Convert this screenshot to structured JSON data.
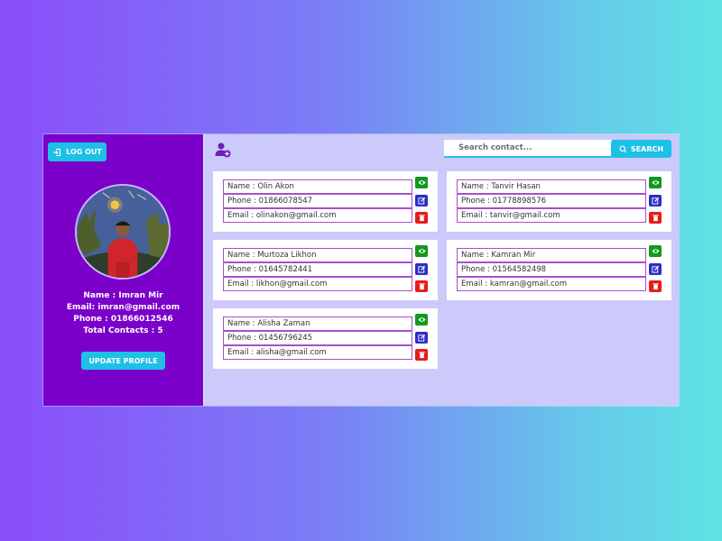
{
  "sidebar": {
    "logout_label": "LOG OUT",
    "profile": {
      "name_line": "Name : Imran Mir",
      "email_line": "Email: imran@gmail.com",
      "phone_line": "Phone : 01866012546",
      "total_line": "Total Contacts : 5"
    },
    "update_label": "UPDATE PROFILE"
  },
  "header": {
    "add_contact_icon": "add-user-icon",
    "search_placeholder": "Search contact...",
    "search_label": "SEARCH"
  },
  "contacts": [
    {
      "name": "Name : Olin Akon",
      "phone": "Phone : 01866078547",
      "email": "Email : olinakon@gmail.com"
    },
    {
      "name": "Name : Tanvir Hasan",
      "phone": "Phone : 01778898576",
      "email": "Email : tanvir@gmail.com"
    },
    {
      "name": "Name : Murtoza Likhon",
      "phone": "Phone : 01645782441",
      "email": "Email : likhon@gmail.com"
    },
    {
      "name": "Name : Kamran Mir",
      "phone": "Phone : 01564582498",
      "email": "Email : kamran@gmail.com"
    },
    {
      "name": "Name : Alisha Zaman",
      "phone": "Phone : 01456796245",
      "email": "Email : alisha@gmail.com"
    }
  ],
  "colors": {
    "sidebar_bg": "#7b00c9",
    "main_bg": "#ccc9fb",
    "accent": "#1ec0e6",
    "view": "#119a1f",
    "edit": "#2b2fc4",
    "delete": "#e61b1b"
  }
}
